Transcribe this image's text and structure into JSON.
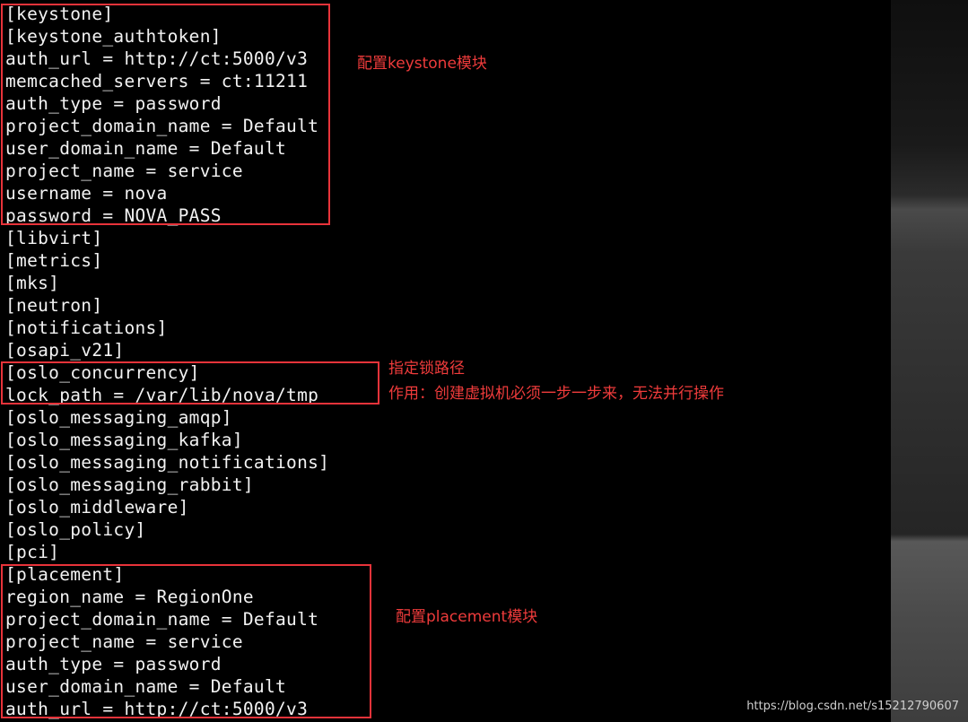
{
  "terminal": {
    "lines": [
      "[keystone]",
      "[keystone_authtoken]",
      "auth_url = http://ct:5000/v3",
      "memcached_servers = ct:11211",
      "auth_type = password",
      "project_domain_name = Default",
      "user_domain_name = Default",
      "project_name = service",
      "username = nova",
      "password = NOVA_PASS",
      "[libvirt]",
      "[metrics]",
      "[mks]",
      "[neutron]",
      "[notifications]",
      "[osapi_v21]",
      "[oslo_concurrency]",
      "lock_path = /var/lib/nova/tmp",
      "[oslo_messaging_amqp]",
      "[oslo_messaging_kafka]",
      "[oslo_messaging_notifications]",
      "[oslo_messaging_rabbit]",
      "[oslo_middleware]",
      "[oslo_policy]",
      "[pci]",
      "[placement]",
      "region_name = RegionOne",
      "project_domain_name = Default",
      "project_name = service",
      "auth_type = password",
      "user_domain_name = Default",
      "auth_url = http://ct:5000/v3"
    ]
  },
  "annotations": {
    "keystone_note": "配置keystone模块",
    "lock_note_line1": "指定锁路径",
    "lock_note_line2": "作用：创建虚拟机必须一步一步来，无法并行操作",
    "placement_note": "配置placement模块"
  },
  "watermark": "https://blog.csdn.net/s15212790607",
  "colors": {
    "background": "#000000",
    "text": "#f2f2f2",
    "highlight": "#e8333a"
  }
}
